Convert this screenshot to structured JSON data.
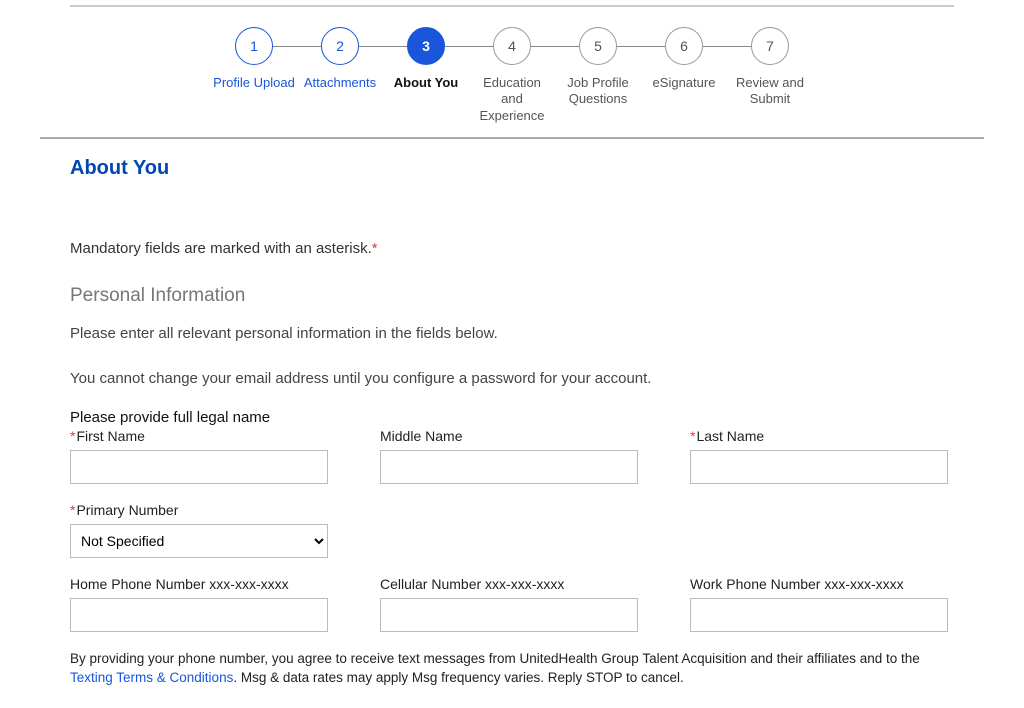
{
  "stepper": {
    "steps": [
      {
        "num": "1",
        "label": "Profile Upload",
        "state": "completed"
      },
      {
        "num": "2",
        "label": "Attachments",
        "state": "completed"
      },
      {
        "num": "3",
        "label": "About You",
        "state": "active"
      },
      {
        "num": "4",
        "label": "Education and Experience",
        "state": "future"
      },
      {
        "num": "5",
        "label": "Job Profile Questions",
        "state": "future"
      },
      {
        "num": "6",
        "label": "eSignature",
        "state": "future"
      },
      {
        "num": "7",
        "label": "Review and Submit",
        "state": "future"
      }
    ]
  },
  "section": {
    "title": "About You",
    "mandatory_note": "Mandatory fields are marked with an asterisk.",
    "asterisk": "*",
    "sub_heading": "Personal Information",
    "instruction1": "Please enter all relevant personal information in the fields below.",
    "instruction2": "You cannot change your email address until you configure a password for your account.",
    "legal_name_prompt": "Please provide full legal name",
    "fields": {
      "first_name_label": "First Name",
      "middle_name_label": "Middle Name",
      "last_name_label": "Last Name",
      "primary_number_label": "Primary Number",
      "primary_number_value": "Not Specified",
      "home_phone_label": "Home Phone Number xxx-xxx-xxxx",
      "cellular_label": "Cellular Number xxx-xxx-xxxx",
      "work_phone_label": "Work Phone Number xxx-xxx-xxxx"
    },
    "consent": {
      "part1": "By providing your phone number, you agree to receive text messages from UnitedHealth Group Talent Acquisition and their affiliates and to the ",
      "link": "Texting Terms & Conditions",
      "part2": ". Msg & data rates may apply Msg frequency varies. Reply STOP to cancel."
    }
  }
}
